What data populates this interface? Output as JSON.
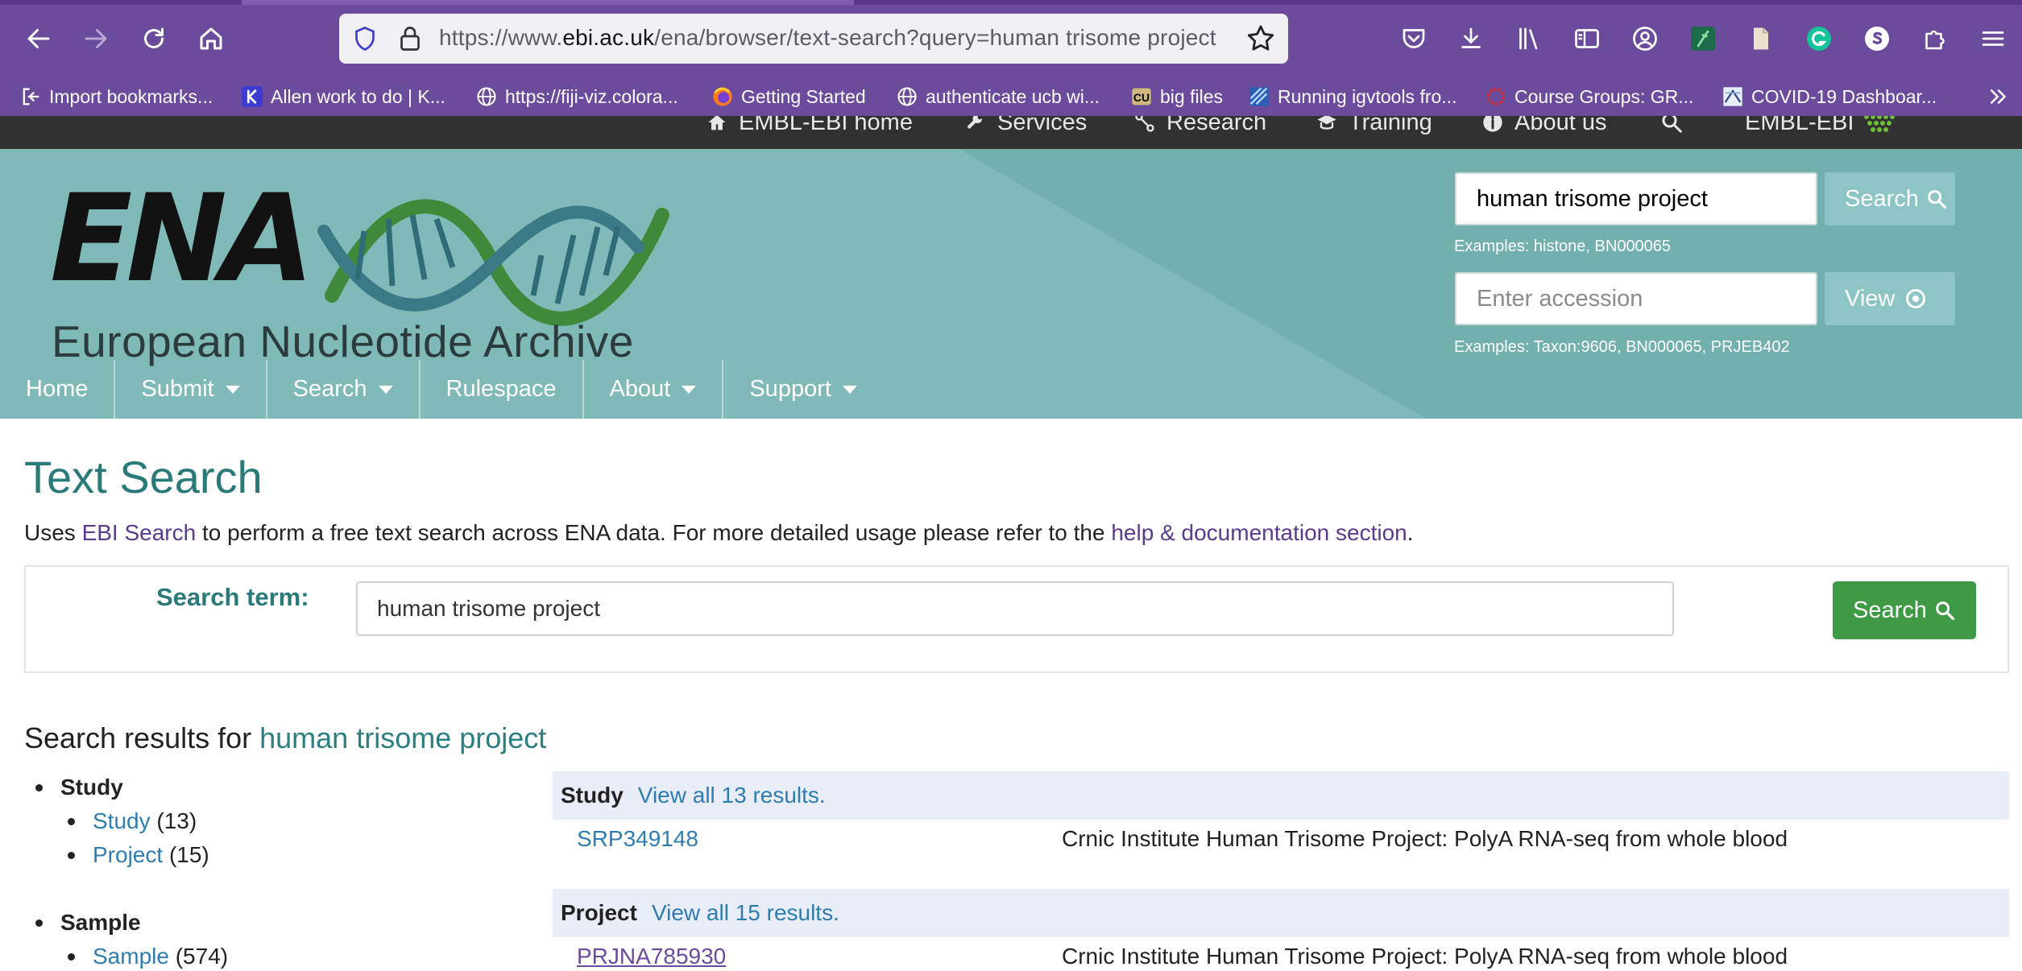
{
  "browser": {
    "url_prefix": "https://www.",
    "url_domain": "ebi.ac.uk",
    "url_path": "/ena/browser/text-search?query=human trisome project",
    "bookmarks": [
      {
        "label": "Import bookmarks...",
        "icon": "import-icon"
      },
      {
        "label": "Allen work to do | K...",
        "icon": "k-icon"
      },
      {
        "label": "https://fiji-viz.colora...",
        "icon": "globe-icon"
      },
      {
        "label": "Getting Started",
        "icon": "firefox-icon"
      },
      {
        "label": "authenticate ucb wi...",
        "icon": "globe-icon"
      },
      {
        "label": "big files",
        "icon": "cu-icon"
      },
      {
        "label": "Running igvtools fro...",
        "icon": "igv-icon"
      },
      {
        "label": "Course Groups: GR...",
        "icon": "gear-red-icon"
      },
      {
        "label": "COVID-19 Dashboar...",
        "icon": "covid-icon"
      }
    ]
  },
  "ebi_bar": {
    "items": [
      "EMBL-EBI home",
      "Services",
      "Research",
      "Training",
      "About us"
    ],
    "brand": "EMBL-EBI"
  },
  "header": {
    "logo_text": "ENA",
    "logo_subtitle": "European Nucleotide Archive",
    "search_value": "human trisome project",
    "search_button": "Search",
    "search_examples": "Examples: histone, BN000065",
    "accession_placeholder": "Enter accession",
    "view_button": "View",
    "accession_examples": "Examples: Taxon:9606, BN000065, PRJEB402"
  },
  "nav": {
    "items": [
      {
        "label": "Home",
        "dropdown": false
      },
      {
        "label": "Submit",
        "dropdown": true
      },
      {
        "label": "Search",
        "dropdown": true
      },
      {
        "label": "Rulespace",
        "dropdown": false
      },
      {
        "label": "About",
        "dropdown": true
      },
      {
        "label": "Support",
        "dropdown": true
      }
    ]
  },
  "page": {
    "title": "Text Search",
    "intro_before": "Uses ",
    "intro_link1": "EBI Search",
    "intro_middle": " to perform a free text search across ENA data. For more detailed usage please refer to the ",
    "intro_link2": "help & documentation section",
    "intro_after": ".",
    "search_label": "Search term:",
    "search_value": "human trisome project",
    "search_button": "Search",
    "results_prefix": "Search results for ",
    "results_query": "human trisome project"
  },
  "facets": {
    "study_group": "Study",
    "study_label": "Study",
    "study_count": "(13)",
    "project_label": "Project",
    "project_count": "(15)",
    "sample_group": "Sample",
    "sample_label": "Sample",
    "sample_count": "(574)"
  },
  "results": {
    "study": {
      "name": "Study",
      "view_all": "View all 13 results.",
      "rows": [
        {
          "accession": "SRP349148",
          "description": "Crnic Institute Human Trisome Project: PolyA RNA-seq from whole blood"
        }
      ]
    },
    "project": {
      "name": "Project",
      "view_all": "View all 15 results.",
      "rows": [
        {
          "accession": "PRJNA785930",
          "description": "Crnic Institute Human Trisome Project: PolyA RNA-seq from whole blood"
        }
      ]
    }
  },
  "colors": {
    "browser_chrome": "#6a4b9c",
    "header_teal": "#7fbab8",
    "title_teal": "#2a7a7a",
    "search_green": "#3f9a45",
    "link_blue": "#2f7db0"
  }
}
